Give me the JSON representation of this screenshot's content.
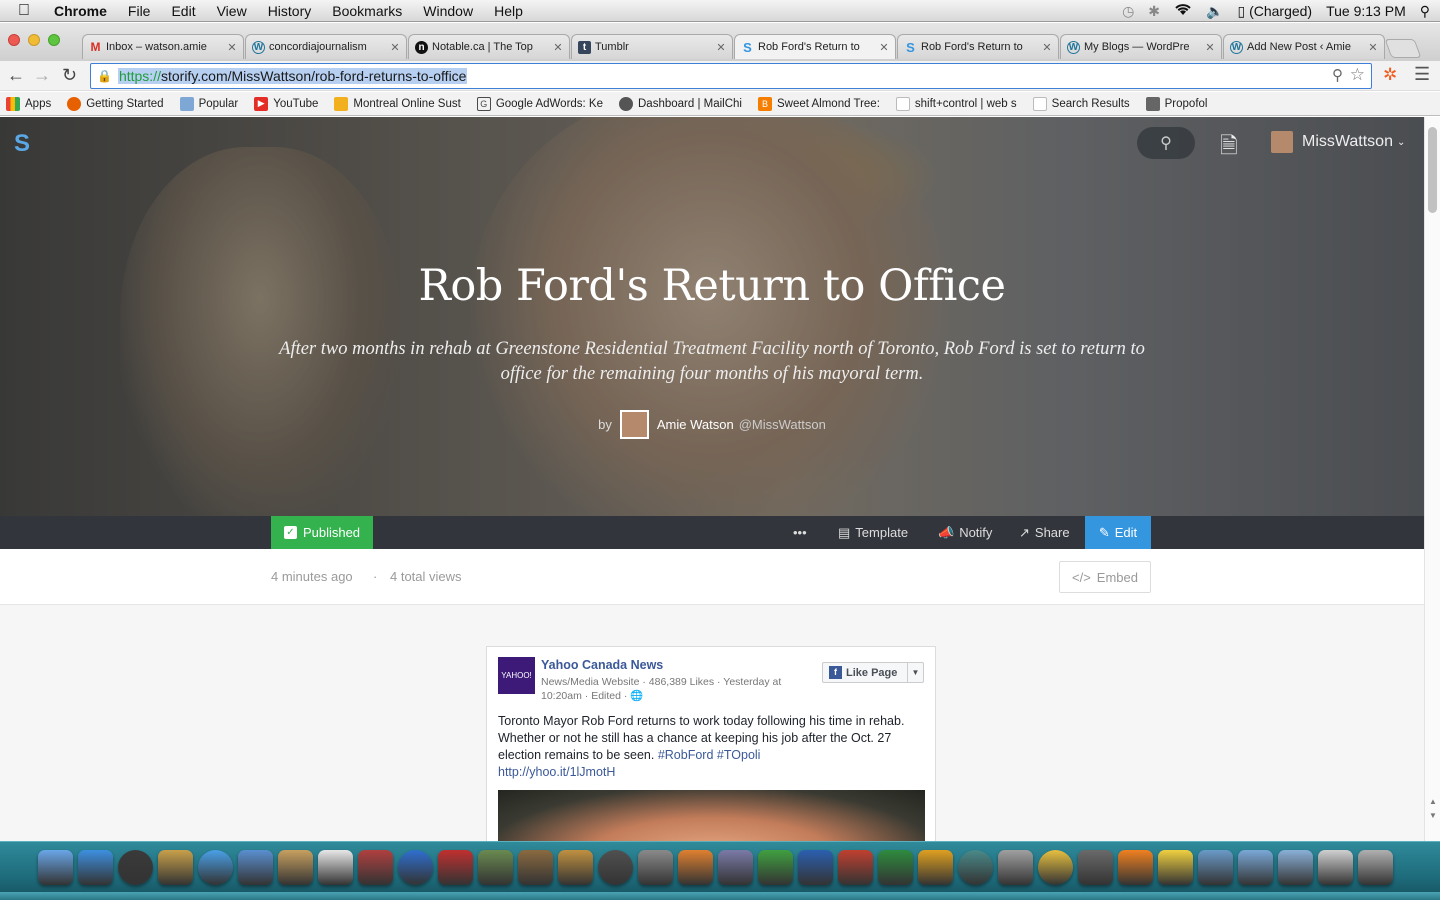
{
  "menubar": {
    "app_name": "Chrome",
    "items": [
      "File",
      "Edit",
      "View",
      "History",
      "Bookmarks",
      "Window",
      "Help"
    ],
    "battery": "(Charged)",
    "clock": "Tue 9:13 PM"
  },
  "tabs": [
    {
      "title": "Inbox – watson.amie",
      "icon": "gmail-icon",
      "color": "#d93025"
    },
    {
      "title": "concordiajournalism",
      "icon": "wordpress-icon",
      "color": "#21759b"
    },
    {
      "title": "Notable.ca | The Top",
      "icon": "notable-icon",
      "color": "#111111"
    },
    {
      "title": "Tumblr",
      "icon": "tumblr-icon",
      "color": "#35465c"
    },
    {
      "title": "Rob Ford's Return to",
      "icon": "storify-icon",
      "color": "#3596e0"
    },
    {
      "title": "Rob Ford's Return to",
      "icon": "storify-icon",
      "color": "#3596e0"
    },
    {
      "title": "My Blogs — WordPre",
      "icon": "wordpress-icon",
      "color": "#21759b"
    },
    {
      "title": "Add New Post ‹ Amie",
      "icon": "wordpress-icon",
      "color": "#21759b"
    }
  ],
  "address_bar": {
    "scheme": "https://",
    "url_rest": "storify.com/MissWattson/rob-ford-returns-to-office"
  },
  "bookmarks": [
    {
      "label": "Apps",
      "icon": "apps-grid-icon",
      "color": "#e94235"
    },
    {
      "label": "Getting Started",
      "icon": "firefox-icon",
      "color": "#e66000"
    },
    {
      "label": "Popular",
      "icon": "folder-icon",
      "color": "#7fa7d6"
    },
    {
      "label": "YouTube",
      "icon": "youtube-icon",
      "color": "#e52d27"
    },
    {
      "label": "Montreal Online Sust",
      "icon": "page-icon",
      "color": "#f2b01e"
    },
    {
      "label": "Google AdWords: Ke",
      "icon": "adwords-icon",
      "color": "#4a4a4a"
    },
    {
      "label": "Dashboard | MailChi",
      "icon": "mailchimp-icon",
      "color": "#555555"
    },
    {
      "label": "Sweet Almond Tree:",
      "icon": "blogger-icon",
      "color": "#f57d00"
    },
    {
      "label": "shift+control | web s",
      "icon": "page-icon",
      "color": "#dddddd"
    },
    {
      "label": "Search Results",
      "icon": "page-icon",
      "color": "#dddddd"
    },
    {
      "label": "Propofol",
      "icon": "page-icon",
      "color": "#666666"
    }
  ],
  "site": {
    "username": "MissWattson",
    "story_title": "Rob Ford's Return to Office",
    "story_description": "After two months in rehab at Greenstone Residential Treatment Facility north of Toronto, Rob Ford is set to return to office for the remaining four months of his mayoral term.",
    "by": "by",
    "author_name": "Amie Watson",
    "author_handle": "@MissWattson",
    "status_label": "Published",
    "more_label": "•••",
    "template_label": "Template",
    "notify_label": "Notify",
    "share_label": "Share",
    "edit_label": "Edit",
    "time_ago": "4 minutes ago",
    "separator": "·",
    "views": "4 total views",
    "embed_label": "Embed",
    "accent_color": "#3596e0",
    "published_color": "#33b24d"
  },
  "facebook_post": {
    "logo_text": "YAHOO!",
    "page_name": "Yahoo Canada News",
    "meta": "News/Media Website · 486,389 Likes · Yesterday at 10:20am · Edited · ",
    "like_label": "Like Page",
    "text_main": "Toronto Mayor Rob Ford returns to work today following his time in rehab. Whether or not he still has a chance at keeping his job after the Oct. 27 election remains to be seen. ",
    "hashtag1": "#RobFord",
    "hashtag2": "#TOpoli",
    "link": "http://yhoo.it/1lJmotH"
  },
  "dock_icons": [
    "finder-icon",
    "app-store-icon",
    "dashboard-icon",
    "mail-eagle-icon",
    "safari-icon",
    "facetime-icon",
    "contacts-icon",
    "calendar-icon",
    "photo-booth-icon",
    "itunes-icon",
    "photo-icon",
    "iphoto-icon",
    "imovie-icon",
    "garageband-icon",
    "time-machine-icon",
    "system-preferences-icon",
    "keynote-icon",
    "script-editor-icon",
    "numbers-icon",
    "word-icon",
    "powerpoint-icon",
    "excel-icon",
    "outlook-icon",
    "network-icon",
    "printer-icon",
    "chrome-icon",
    "grapher-icon",
    "vlc-icon",
    "cyberduck-icon",
    "applications-folder-icon",
    "documents-folder-icon",
    "downloads-icon",
    "preview-icon",
    "trash-icon"
  ]
}
